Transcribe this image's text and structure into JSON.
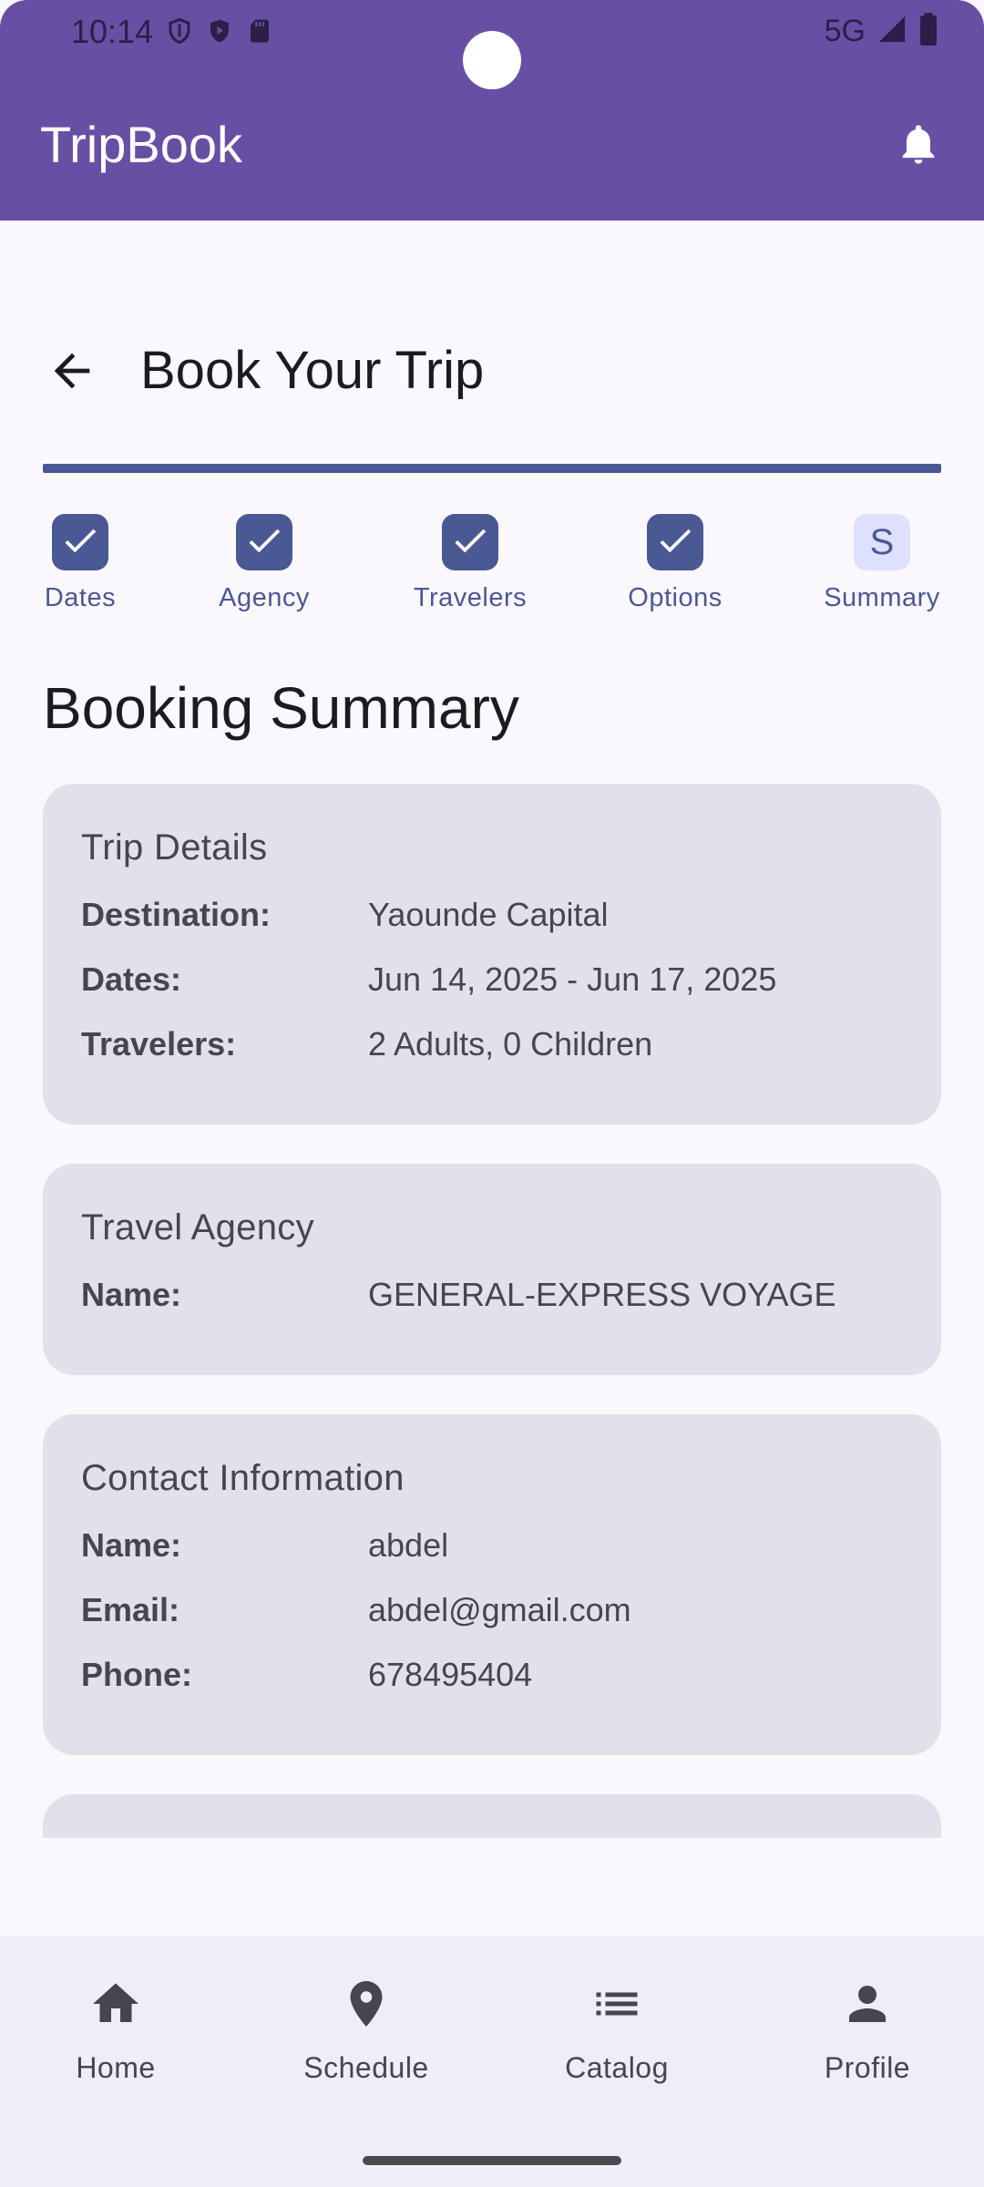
{
  "status_bar": {
    "time": "10:14",
    "network": "5G"
  },
  "app_bar": {
    "title": "TripBook",
    "notification_icon": "bell-icon"
  },
  "header": {
    "back_icon": "arrow-left-icon",
    "title": "Book Your Trip"
  },
  "stepper": {
    "steps": [
      {
        "label": "Dates",
        "state": "done"
      },
      {
        "label": "Agency",
        "state": "done"
      },
      {
        "label": "Travelers",
        "state": "done"
      },
      {
        "label": "Options",
        "state": "done"
      },
      {
        "label": "Summary",
        "state": "current",
        "letter": "S"
      }
    ]
  },
  "summary": {
    "title": "Booking Summary",
    "trip": {
      "title": "Trip Details",
      "rows": [
        {
          "key": "Destination:",
          "value": "Yaounde Capital"
        },
        {
          "key": "Dates:",
          "value": "Jun 14, 2025 - Jun 17, 2025"
        },
        {
          "key": "Travelers:",
          "value": "2 Adults, 0 Children"
        }
      ]
    },
    "agency": {
      "title": "Travel Agency",
      "rows": [
        {
          "key": "Name:",
          "value": "GENERAL-EXPRESS VOYAGE"
        }
      ]
    },
    "contact": {
      "title": "Contact Information",
      "rows": [
        {
          "key": "Name:",
          "value": "abdel"
        },
        {
          "key": "Email:",
          "value": "abdel@gmail.com"
        },
        {
          "key": "Phone:",
          "value": "678495404"
        }
      ]
    }
  },
  "bottom_nav": {
    "items": [
      {
        "label": "Home",
        "icon": "home-icon"
      },
      {
        "label": "Schedule",
        "icon": "location-pin-icon"
      },
      {
        "label": "Catalog",
        "icon": "list-icon"
      },
      {
        "label": "Profile",
        "icon": "person-icon"
      }
    ]
  },
  "colors": {
    "primary": "#6750a4",
    "accent": "#4a5894",
    "card": "#e2e1ea",
    "background": "#fbf8fd"
  }
}
